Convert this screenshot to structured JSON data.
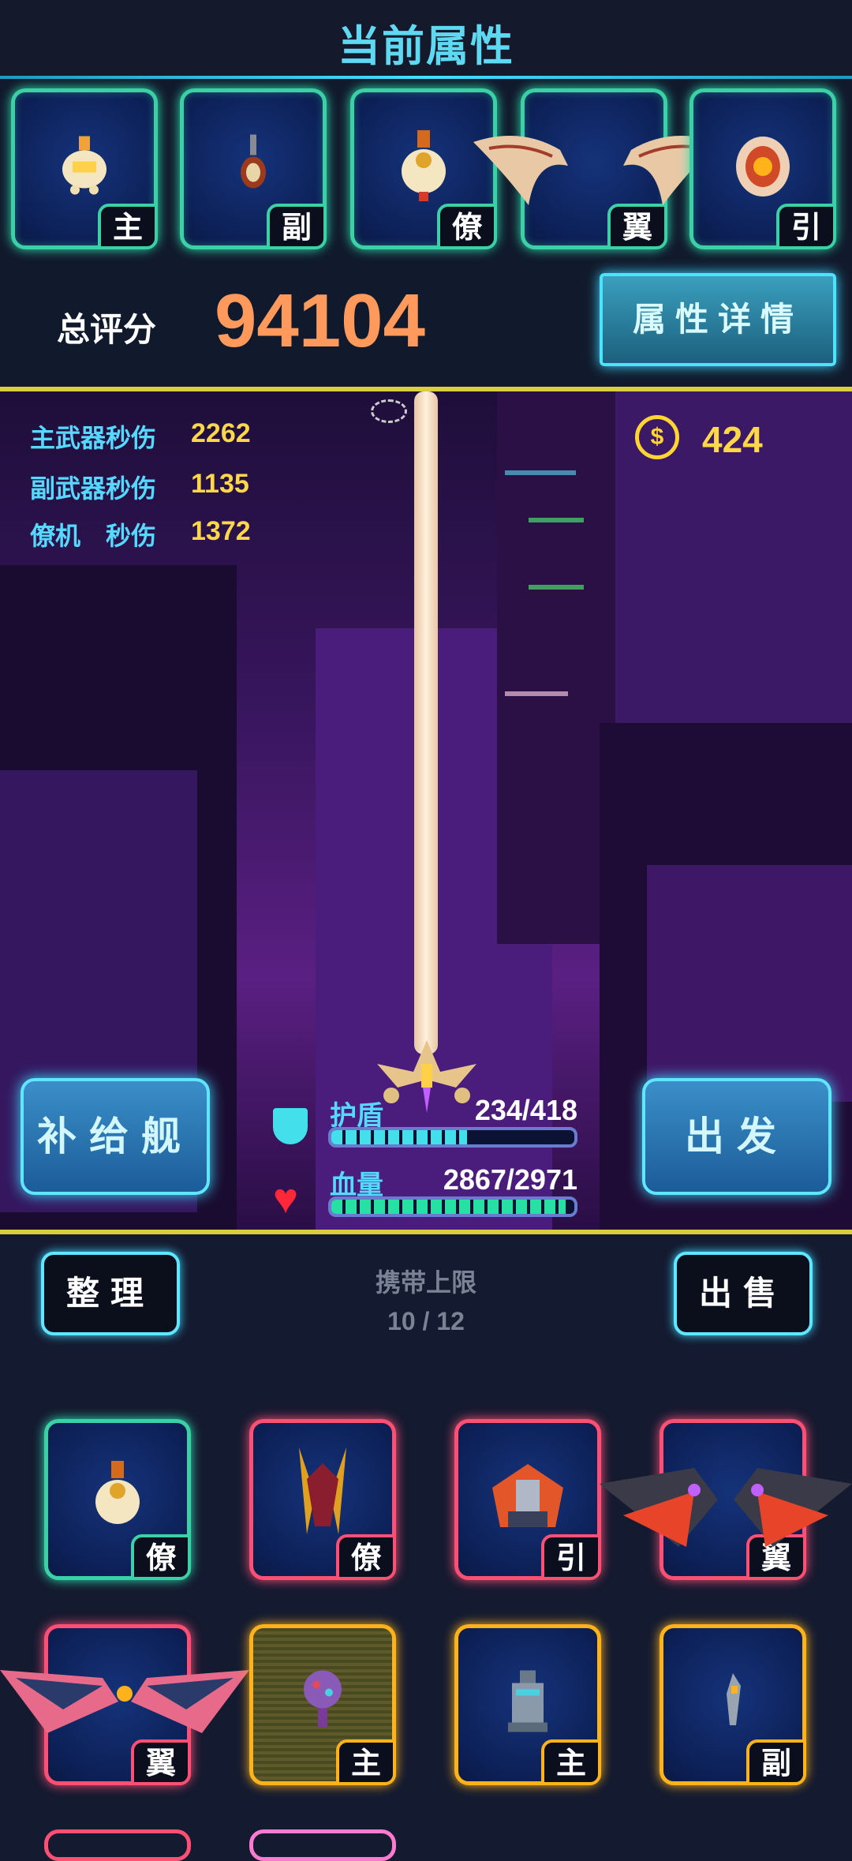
{
  "header": {
    "title": "当前属性"
  },
  "equipment": [
    {
      "tag": "主",
      "rarity": "green"
    },
    {
      "tag": "副",
      "rarity": "green"
    },
    {
      "tag": "僚",
      "rarity": "green"
    },
    {
      "tag": "翼",
      "rarity": "green"
    },
    {
      "tag": "引",
      "rarity": "green"
    }
  ],
  "score": {
    "label": "总评分",
    "value": "94104",
    "detail_button": "属性详情"
  },
  "stats": [
    {
      "label": "主武器秒伤",
      "value": "2262"
    },
    {
      "label": "副武器秒伤",
      "value": "1135"
    },
    {
      "label": "僚机　秒伤",
      "value": "1372"
    }
  ],
  "coins": {
    "icon": "coin-icon",
    "value": "424"
  },
  "supply_button": "补给舰",
  "depart_button": "出发",
  "shield": {
    "label": "护盾",
    "value": "234/418",
    "fraction": 0.56,
    "color": "#43dfea"
  },
  "health": {
    "label": "血量",
    "value": "2867/2971",
    "fraction": 0.965,
    "color": "#27e0a4"
  },
  "inventory": {
    "sort_button": "整理",
    "sell_button": "出售",
    "capacity_label": "携带上限",
    "capacity_value": "10 / 12",
    "items": [
      {
        "tag": "僚",
        "rarity": "green"
      },
      {
        "tag": "僚",
        "rarity": "pink"
      },
      {
        "tag": "引",
        "rarity": "pink"
      },
      {
        "tag": "翼",
        "rarity": "pink"
      },
      {
        "tag": "翼",
        "rarity": "pink"
      },
      {
        "tag": "主",
        "rarity": "gold"
      },
      {
        "tag": "主",
        "rarity": "gold"
      },
      {
        "tag": "副",
        "rarity": "gold"
      }
    ]
  },
  "colors": {
    "accent": "#5fd8f2",
    "score": "#ff9a5c",
    "stat_value": "#ffd84a",
    "green_frame": "#3bd0a6",
    "pink_frame": "#ff4f74",
    "gold_frame": "#ffb21a"
  }
}
